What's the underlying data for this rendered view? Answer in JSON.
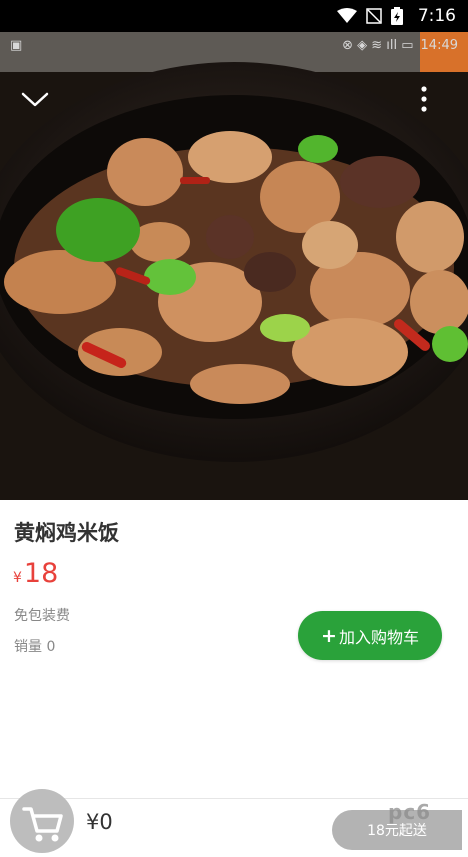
{
  "status_bar": {
    "time": "7:16"
  },
  "photo_status": {
    "time": "14:49"
  },
  "product": {
    "name": "黄焖鸡米饭",
    "currency": "¥",
    "price": "18",
    "note_packaging": "免包装费",
    "sales": "销量 0"
  },
  "actions": {
    "add_to_cart_plus": "+",
    "add_to_cart": "加入购物车"
  },
  "cart": {
    "total": "¥0",
    "min_order": "18元起送"
  },
  "watermark": "pc6",
  "colors": {
    "price": "#e8413b",
    "add_button": "#2aa23a",
    "cart_circle": "#bdbdbd",
    "min_order_bg": "#b3b3b3"
  },
  "icons": {
    "back": "chevron-down-icon",
    "more": "more-vertical-icon",
    "cart": "shopping-cart-icon",
    "wifi": "wifi-icon",
    "battery": "battery-icon"
  }
}
